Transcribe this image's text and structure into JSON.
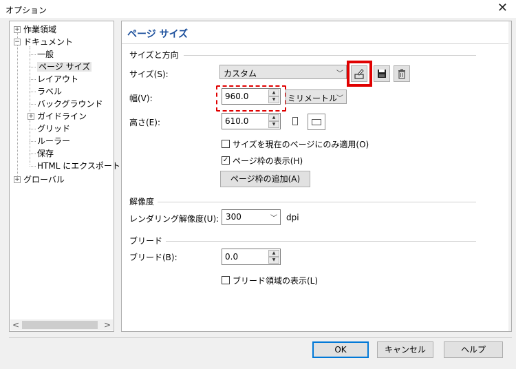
{
  "window": {
    "title": "オプション",
    "close_glyph": "✕"
  },
  "tree": {
    "items": [
      {
        "label": "作業領域",
        "expander": "+"
      },
      {
        "label": "ドキュメント",
        "expander": "−"
      },
      {
        "label": "一般"
      },
      {
        "label": "ページ サイズ",
        "selected": true
      },
      {
        "label": "レイアウト"
      },
      {
        "label": "ラベル"
      },
      {
        "label": "バックグラウンド"
      },
      {
        "label": "ガイドライン",
        "expander": "+"
      },
      {
        "label": "グリッド"
      },
      {
        "label": "ルーラー"
      },
      {
        "label": "保存"
      },
      {
        "label": "HTML にエクスポート"
      },
      {
        "label": "グローバル",
        "expander": "+"
      }
    ],
    "scroll_left": "<",
    "scroll_right": ">"
  },
  "panel": {
    "title": "ページ サイズ",
    "size_section": {
      "heading": "サイズと方向",
      "size_label": "サイズ(S):",
      "size_value": "カスタム",
      "width_label": "幅(V):",
      "width_value": "960.0",
      "unit_value": "ミリメートル",
      "height_label": "高さ(E):",
      "height_value": "610.0",
      "apply_current_label": "サイズを現在のページにのみ適用(O)",
      "apply_current_checked": false,
      "show_border_label": "ページ枠の表示(H)",
      "show_border_checked": true,
      "add_border_button": "ページ枠の追加(A)"
    },
    "resolution_section": {
      "heading": "解像度",
      "rendering_label": "レンダリング解像度(U):",
      "rendering_value": "300",
      "rendering_unit": "dpi"
    },
    "bleed_section": {
      "heading": "ブリード",
      "bleed_label": "ブリード(B):",
      "bleed_value": "0.0",
      "show_bleed_label": "ブリード領域の表示(L)",
      "show_bleed_checked": false
    }
  },
  "footer": {
    "ok": "OK",
    "cancel": "キャンセル",
    "help": "ヘルプ"
  },
  "colors": {
    "title_blue": "#1b4f9c",
    "annotation_red": "#e00000"
  }
}
